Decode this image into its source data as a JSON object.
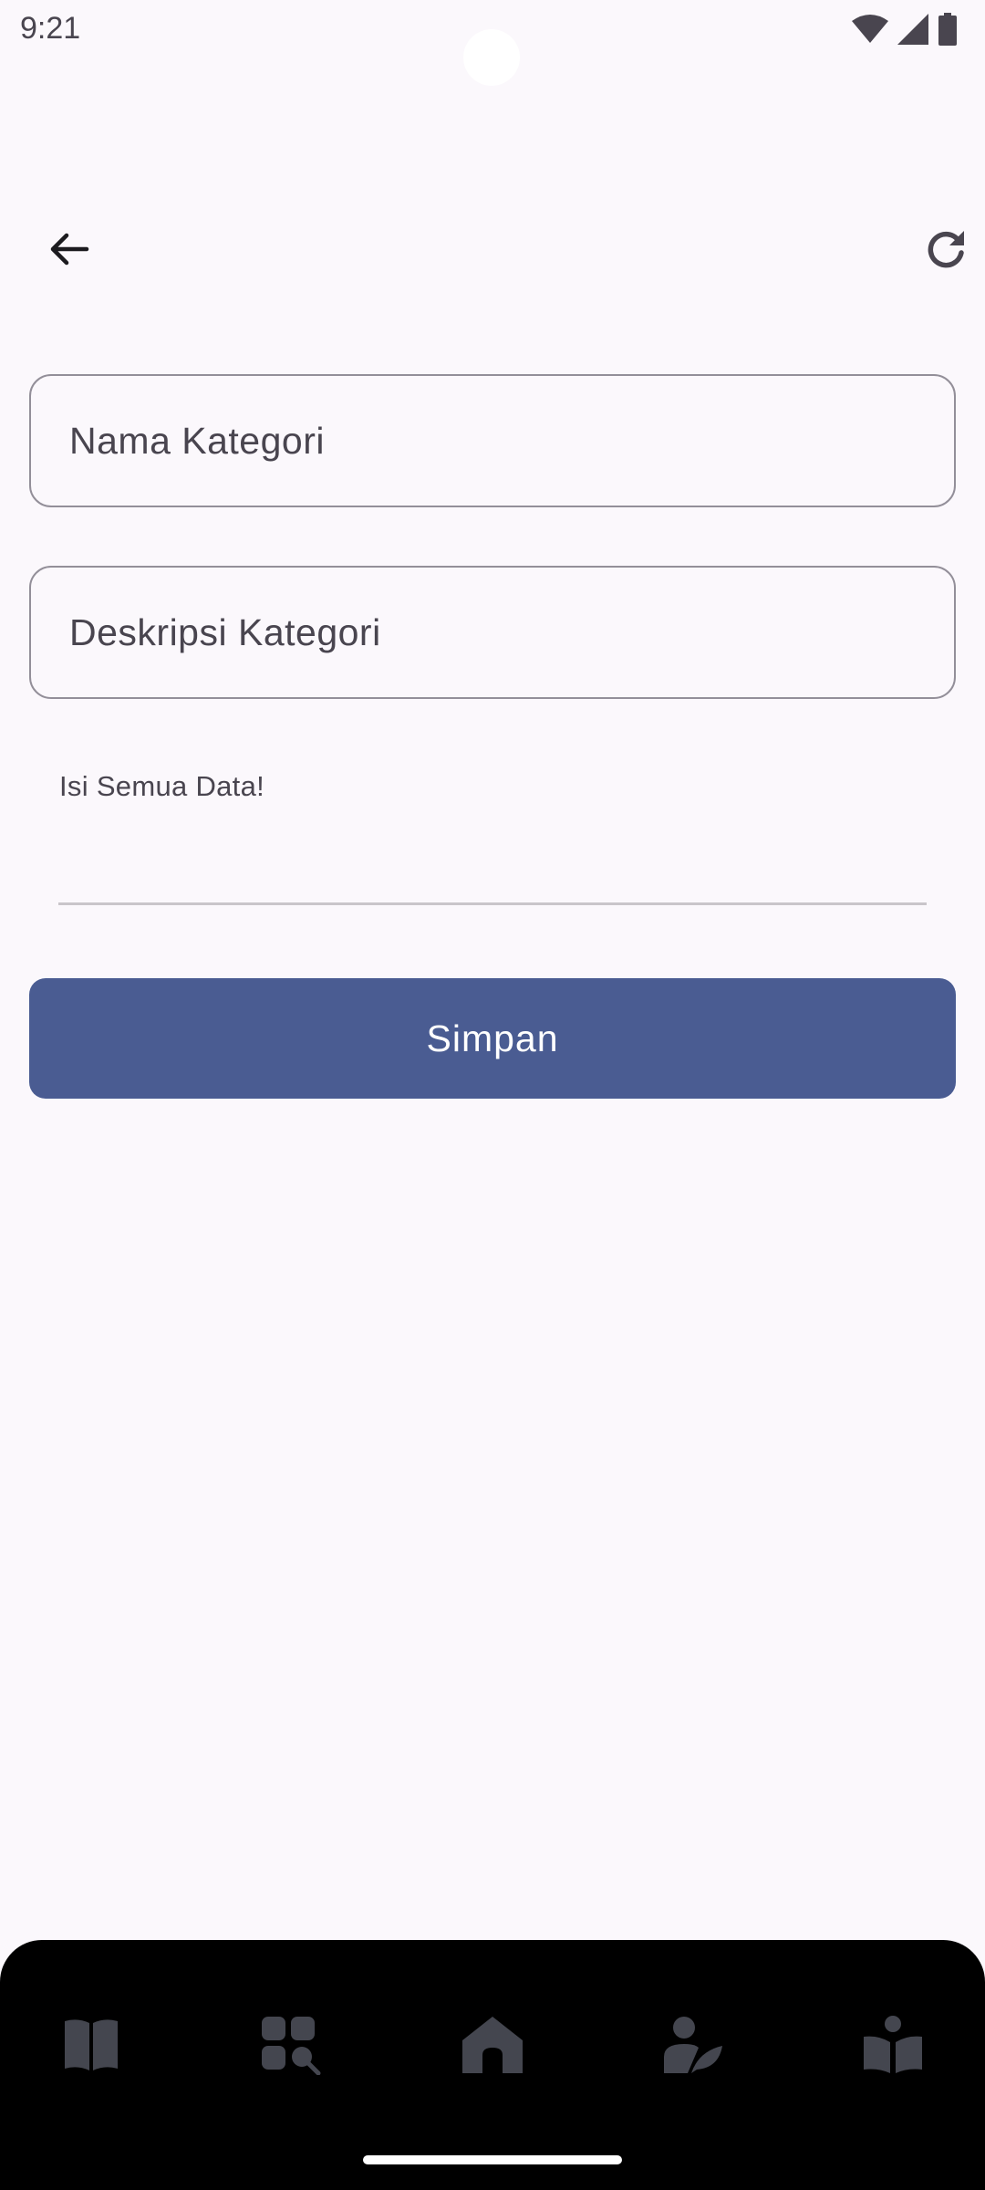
{
  "status_bar": {
    "time": "9:21",
    "icons": [
      "wifi-icon",
      "signal-icon",
      "battery-icon"
    ]
  },
  "app_bar": {
    "back_icon": "arrow-back-icon",
    "refresh_icon": "refresh-icon"
  },
  "form": {
    "name_field": {
      "value": "",
      "placeholder": "Nama Kategori"
    },
    "description_field": {
      "value": "",
      "placeholder": "Deskripsi Kategori"
    },
    "error_text": "Isi Semua Data!",
    "save_label": "Simpan"
  },
  "bottom_nav": {
    "items": [
      {
        "icon": "book-icon"
      },
      {
        "icon": "category-search-icon"
      },
      {
        "icon": "home-icon"
      },
      {
        "icon": "person-leaf-icon"
      },
      {
        "icon": "reader-icon"
      }
    ]
  },
  "colors": {
    "background": "#fbf8fc",
    "primary": "#4a5c92",
    "outline": "#938f99",
    "nav_background": "#000000",
    "nav_icon": "#44464f"
  }
}
